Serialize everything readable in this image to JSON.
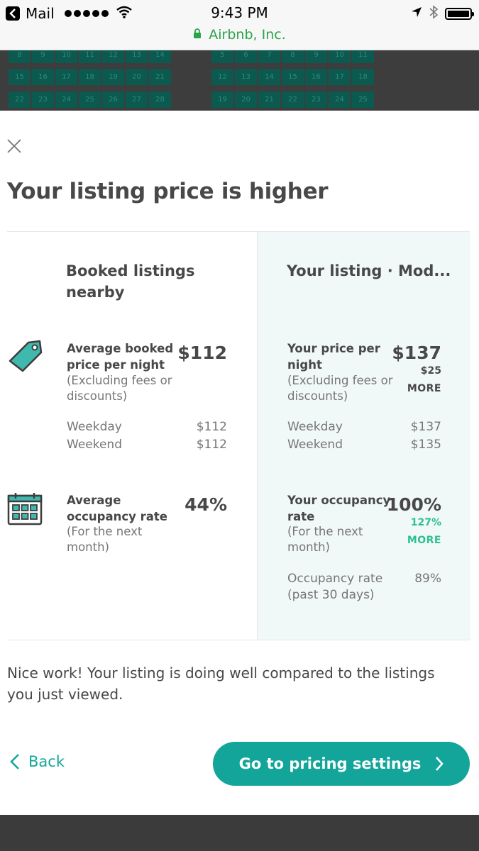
{
  "status_bar": {
    "back_app": "Mail",
    "time": "9:43 PM",
    "url_label": "Airbnb, Inc.",
    "signal_dots": 5,
    "icons": [
      "back-icon",
      "wifi-icon",
      "location-icon",
      "bluetooth-icon",
      "battery-icon",
      "lock-icon"
    ]
  },
  "background_calendar": {
    "left_rows": [
      [
        "8",
        "9",
        "10",
        "11",
        "12",
        "13",
        "14"
      ],
      [
        "15",
        "16",
        "17",
        "18",
        "19",
        "20",
        "21"
      ],
      [
        "22",
        "23",
        "24",
        "25",
        "26",
        "27",
        "28"
      ]
    ],
    "right_rows": [
      [
        "5",
        "6",
        "7",
        "8",
        "9",
        "10",
        "11"
      ],
      [
        "12",
        "13",
        "14",
        "15",
        "16",
        "17",
        "18"
      ],
      [
        "19",
        "20",
        "21",
        "22",
        "23",
        "24",
        "25"
      ]
    ]
  },
  "modal": {
    "title": "Your listing price is higher",
    "left_column": {
      "heading": "Booked listings nearby",
      "price": {
        "label": "Average booked price per night",
        "sublabel": "(Excluding fees or discounts)",
        "value": "$112",
        "breakdown": [
          {
            "label": "Weekday",
            "value": "$112"
          },
          {
            "label": "Weekend",
            "value": "$112"
          }
        ]
      },
      "occupancy": {
        "label": "Average occupancy rate",
        "sublabel": "(For the next month)",
        "value": "44%"
      }
    },
    "right_column": {
      "heading": "Your listing · Mod...",
      "price": {
        "label": "Your price per night",
        "sublabel": "(Excluding fees or discounts)",
        "value": "$137",
        "diff_value": "$25",
        "diff_label": "MORE",
        "breakdown": [
          {
            "label": "Weekday",
            "value": "$137"
          },
          {
            "label": "Weekend",
            "value": "$135"
          }
        ]
      },
      "occupancy": {
        "label": "Your occupancy rate",
        "sublabel": "(For the next month)",
        "value": "100%",
        "diff_value": "127%",
        "diff_label": "MORE",
        "past_label": "Occupancy rate (past 30 days)",
        "past_value": "89%"
      }
    },
    "footer_message": "Nice work! Your listing is doing well compared to the listings you just viewed.",
    "back_label": "Back",
    "cta_label": "Go to pricing settings"
  },
  "colors": {
    "accent": "#14a59a",
    "positive": "#2ec08d",
    "text": "#484848",
    "muted": "#767676",
    "highlight_bg": "#f1f9f8",
    "url_green": "#2aa44a"
  }
}
